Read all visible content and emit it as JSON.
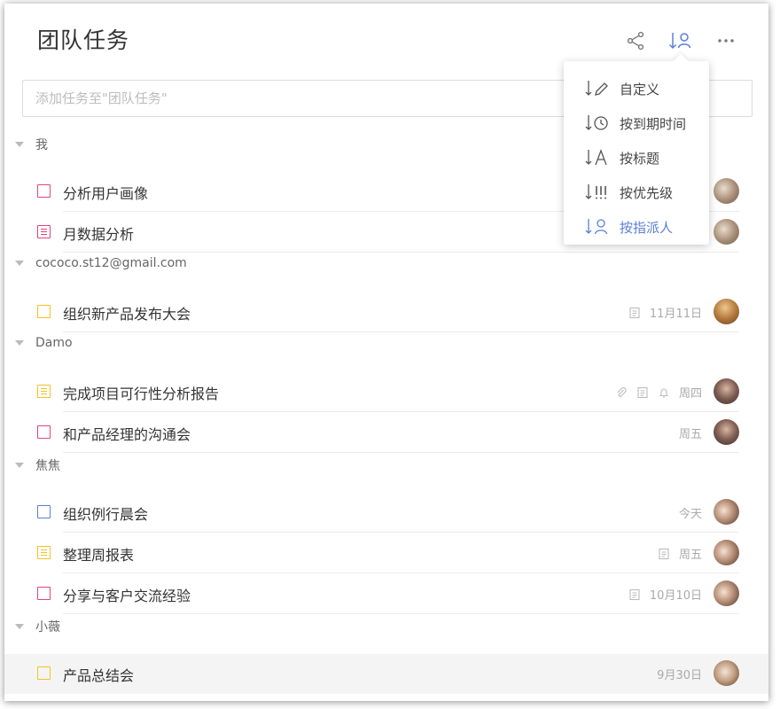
{
  "header": {
    "title": "团队任务"
  },
  "search": {
    "placeholder": "添加任务至\"团队任务\""
  },
  "sort_menu": {
    "items": [
      {
        "label": "自定义",
        "icon": "sort-custom-icon"
      },
      {
        "label": "按到期时间",
        "icon": "sort-due-icon"
      },
      {
        "label": "按标题",
        "icon": "sort-title-icon"
      },
      {
        "label": "按优先级",
        "icon": "sort-priority-icon"
      },
      {
        "label": "按指派人",
        "icon": "sort-assignee-icon",
        "active": true
      }
    ]
  },
  "groups": [
    {
      "name": "我",
      "tasks": [
        {
          "title": "分析用户画像",
          "color": "#e0457b",
          "type": "checkbox"
        },
        {
          "title": "月数据分析",
          "color": "#e0457b",
          "type": "note"
        }
      ]
    },
    {
      "name": "cococo.st12@gmail.com",
      "tasks": [
        {
          "title": "组织新产品发布大会",
          "color": "#f5c122",
          "type": "checkbox",
          "due": "11月11日",
          "note_icon": true
        }
      ]
    },
    {
      "name": "Damo",
      "tasks": [
        {
          "title": "完成项目可行性分析报告",
          "color": "#f5c122",
          "type": "note",
          "due": "周四",
          "note_icon": true,
          "attach_icon": true,
          "bell_icon": true
        },
        {
          "title": "和产品经理的沟通会",
          "color": "#e0457b",
          "type": "checkbox",
          "due": "周五"
        }
      ]
    },
    {
      "name": "焦焦",
      "tasks": [
        {
          "title": "组织例行晨会",
          "color": "#5b7fd6",
          "type": "checkbox",
          "due": "今天"
        },
        {
          "title": "整理周报表",
          "color": "#f5c122",
          "type": "note",
          "due": "周五",
          "note_icon": true
        },
        {
          "title": "分享与客户交流经验",
          "color": "#e0457b",
          "type": "checkbox",
          "due": "10月10日",
          "note_icon": true
        }
      ]
    },
    {
      "name": "小薇",
      "tasks": [
        {
          "title": "产品总结会",
          "color": "#f5c122",
          "type": "checkbox",
          "due": "9月30日",
          "highlighted": true
        }
      ]
    }
  ],
  "colors": {
    "accent": "#5b7fd6",
    "priority_high": "#e0457b",
    "priority_mid": "#f5c122",
    "priority_low": "#5b7fd6"
  }
}
